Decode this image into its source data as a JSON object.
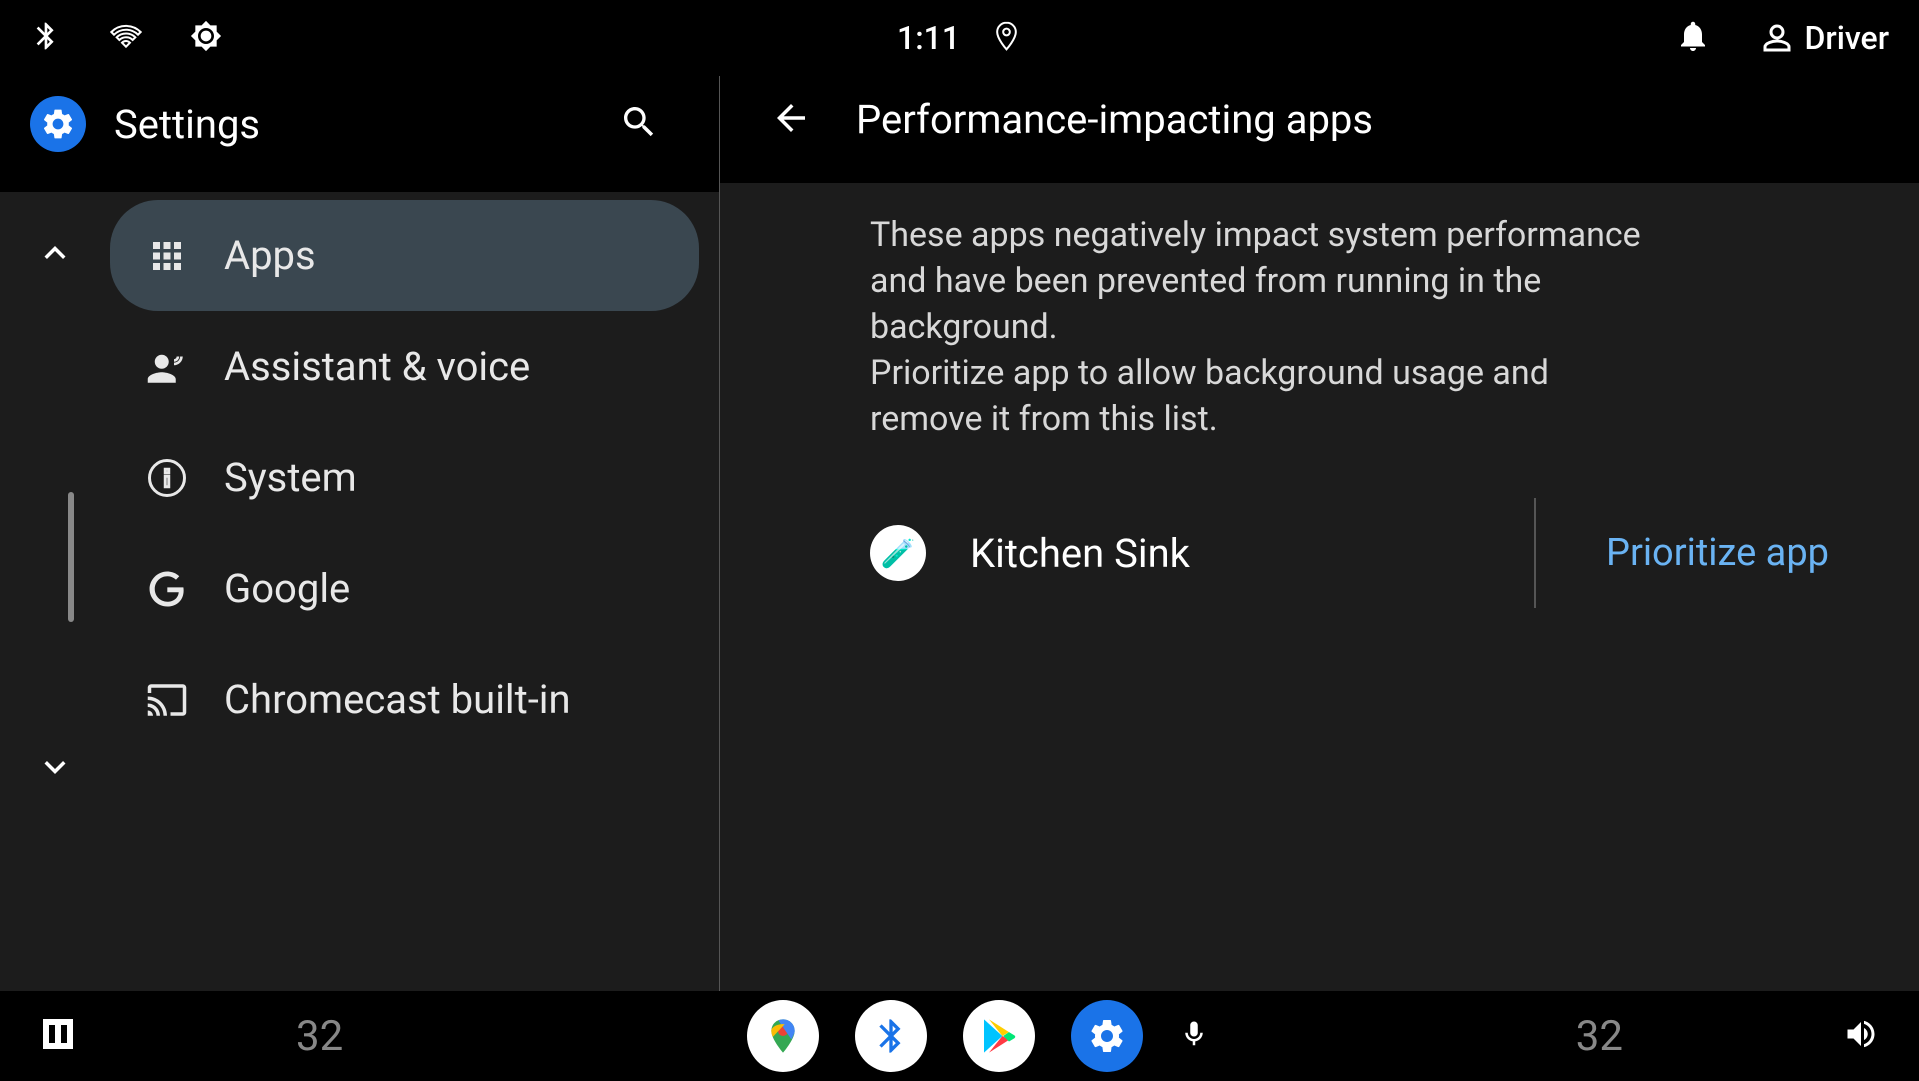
{
  "status": {
    "time": "1:11",
    "user_label": "Driver"
  },
  "sidebar": {
    "title": "Settings",
    "items": [
      {
        "label": "Apps"
      },
      {
        "label": "Assistant & voice"
      },
      {
        "label": "System"
      },
      {
        "label": "Google"
      },
      {
        "label": "Chromecast built-in"
      }
    ]
  },
  "content": {
    "title": "Performance-impacting apps",
    "description": "These apps negatively impact system performance and have been prevented from running in the background.\nPrioritize app to allow background usage and remove it from this list.",
    "apps": [
      {
        "name": "Kitchen Sink",
        "action_label": "Prioritize app"
      }
    ]
  },
  "dock": {
    "temp_left": "32",
    "temp_right": "32"
  },
  "colors": {
    "accent": "#1a73e8",
    "link": "#6ab3f3",
    "panel_bg": "#1c1c1c",
    "selected_bg": "#3a4750"
  }
}
